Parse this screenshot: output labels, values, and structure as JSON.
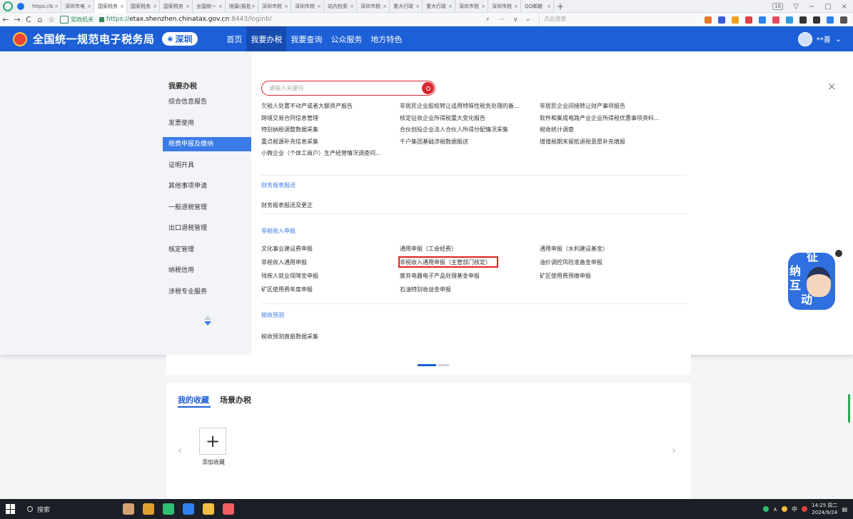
{
  "browser": {
    "tabs": [
      {
        "label": "https://b",
        "active": false
      },
      {
        "label": "深圳市电",
        "active": false
      },
      {
        "label": "国家税务",
        "active": true
      },
      {
        "label": "国家税务",
        "active": false
      },
      {
        "label": "国家税务",
        "active": false
      },
      {
        "label": "全国统一",
        "active": false
      },
      {
        "label": "陪篇(报批",
        "active": false
      },
      {
        "label": "深圳市税",
        "active": false
      },
      {
        "label": "深圳市税",
        "active": false
      },
      {
        "label": "站内检索",
        "active": false
      },
      {
        "label": "深圳市税",
        "active": false
      },
      {
        "label": "重大行政",
        "active": false
      },
      {
        "label": "重大行政",
        "active": false
      },
      {
        "label": "深圳市税",
        "active": false
      },
      {
        "label": "深圳市税",
        "active": false
      },
      {
        "label": "QQ邮箱",
        "active": false
      }
    ],
    "tab_close": "×",
    "new_tab": "+",
    "tab_count_badge": "16",
    "window_controls": {
      "minimize": "−",
      "maximize": "□",
      "close": "×"
    },
    "nav": {
      "back": "←",
      "forward": "→",
      "reload": "C",
      "home": "⌂"
    },
    "url_org": "党政机关",
    "url_scheme": "https://",
    "url_host": "etax.shenzhen.chinatax.gov.cn",
    "url_rest": ":8443/loginb/",
    "addr_extras": {
      "bolt": "⚡",
      "more": "···",
      "dropdown": "∨"
    },
    "search_placeholder": "点此搜索",
    "toolbar_colors": [
      "#e87a2e",
      "#3b5bdb",
      "#f0a020",
      "#e04040",
      "#2f80ed",
      "#e84a5f",
      "#2f9ee0",
      "#333333",
      "#333333",
      "#2f80ed",
      "#555555"
    ]
  },
  "header": {
    "site_title": "全国统一规范电子税务局",
    "city": "深圳",
    "nav": [
      {
        "label": "首页",
        "active": false
      },
      {
        "label": "我要办税",
        "active": true
      },
      {
        "label": "我要查询",
        "active": false
      },
      {
        "label": "公众服务",
        "active": false
      },
      {
        "label": "地方特色",
        "active": false
      }
    ],
    "user_name": "**善",
    "colors": {
      "primary": "#1d5fd6",
      "active_nav": "#164bb0"
    }
  },
  "sidebar": {
    "title": "我要办税",
    "items": [
      {
        "label": "综合信息报告",
        "active": false
      },
      {
        "label": "发票使用",
        "active": false
      },
      {
        "label": "税费申报及缴纳",
        "active": true
      },
      {
        "label": "证明开具",
        "active": false
      },
      {
        "label": "其他事项申请",
        "active": false
      },
      {
        "label": "一般退税管理",
        "active": false
      },
      {
        "label": "出口退税管理",
        "active": false
      },
      {
        "label": "核定管理",
        "active": false
      },
      {
        "label": "纳税信用",
        "active": false
      },
      {
        "label": "涉税专业服务",
        "active": false
      }
    ]
  },
  "menu": {
    "search_placeholder": "请输入关键词",
    "close": "×",
    "top_rows": [
      [
        "欠税人处置不动产或者大额资产报告",
        "非居民企业股权转让适用特殊性税务处理的备...",
        "非居民企业间接转让财产事项报告"
      ],
      [
        "跨境交易合同信息管理",
        "核定征收企业所得税重大变化报告",
        "软件和集成电路产业企业所得税优惠事项资料..."
      ],
      [
        "特别纳税调整数据采集",
        "合伙创投企业法人合伙人所得分配情况采集",
        "税收统计调查"
      ],
      [
        "重点税源补充信息采集",
        "千户集团基础涉税数据报送",
        "增值税期末留抵退税意愿补充填报"
      ],
      [
        "小微企业（个体工商户）生产经营情况调查问...",
        "",
        ""
      ]
    ],
    "sections": [
      {
        "title": "财务报表报送",
        "rows": [
          [
            "财务报表报送及更正",
            "",
            ""
          ]
        ]
      },
      {
        "title": "非税收入申报",
        "rows": [
          [
            "文化事业建设费申报",
            "通用申报（工会经费）",
            "通用申报（水利建设基金）"
          ],
          [
            "非税收入通用申报",
            "非税收入通用申报（主管部门核定）",
            "油价调控风险准备金申报"
          ],
          [
            "残疾人就业保障金申报",
            "废弃电器电子产品处理基金申报",
            "矿区使用费预缴申报"
          ],
          [
            "矿区使用费年度申报",
            "石油特别收益金申报",
            ""
          ]
        ]
      },
      {
        "title": "税收预测",
        "rows": [
          [
            "税收预测直报数据采集",
            "",
            ""
          ]
        ]
      }
    ],
    "highlight_color": "#e02020",
    "link_color": "#3b7be8"
  },
  "favorites": {
    "tabs": [
      {
        "label": "我的收藏",
        "active": true
      },
      {
        "label": "场景办税",
        "active": false
      }
    ],
    "prev": "‹",
    "next": "›",
    "add_icon": "+",
    "add_label": "添加收藏"
  },
  "helper": {
    "chars": [
      "征",
      "纳",
      "互",
      "动"
    ]
  },
  "taskbar": {
    "search_label": "搜索",
    "clock_time": "14:25 周二",
    "clock_date": "2024/9/24",
    "ime": "中",
    "caret": "∧",
    "app_colors": [
      "#d4a373",
      "#e0a030",
      "#2fbf71",
      "#2f80ed",
      "#f0c040",
      "#f06060"
    ]
  }
}
